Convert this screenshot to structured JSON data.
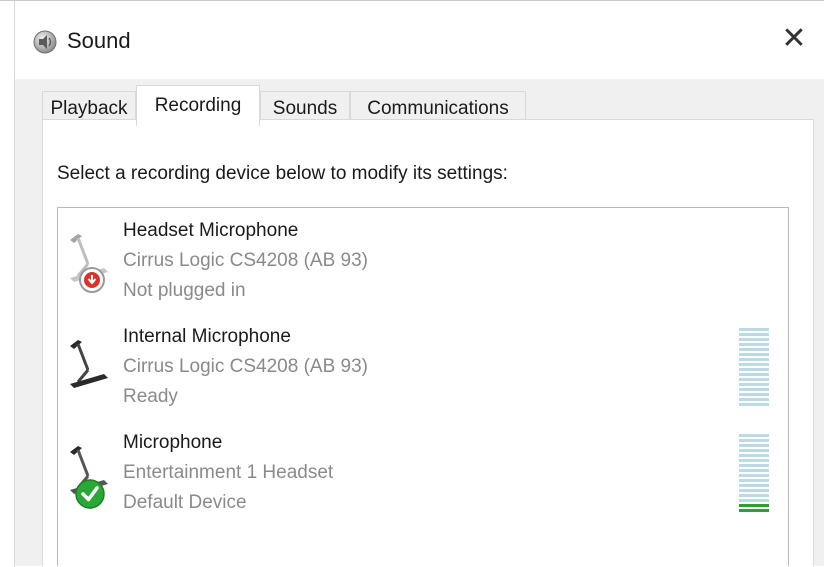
{
  "window": {
    "title": "Sound",
    "close_glyph": "✕"
  },
  "tabs": [
    {
      "label": "Playback",
      "active": false
    },
    {
      "label": "Recording",
      "active": true
    },
    {
      "label": "Sounds",
      "active": false
    },
    {
      "label": "Communications",
      "active": false
    }
  ],
  "panel": {
    "instruction": "Select a recording device below to modify its settings:"
  },
  "devices": [
    {
      "name": "Headset Microphone",
      "driver": "Cirrus Logic CS4208 (AB 93)",
      "status": "Not plugged in",
      "status_icon": "unplugged-icon",
      "disabled_look": true,
      "meter_level": null
    },
    {
      "name": "Internal Microphone",
      "driver": "Cirrus Logic CS4208 (AB 93)",
      "status": "Ready",
      "status_icon": null,
      "disabled_look": false,
      "meter_level": 0.0
    },
    {
      "name": "Microphone",
      "driver": "Entertainment 1 Headset",
      "status": "Default Device",
      "status_icon": "default-device-check-icon",
      "disabled_look": false,
      "meter_level": 0.1
    }
  ],
  "colors": {
    "meter_off": "#bcd9e6",
    "meter_on": "#2f9e35",
    "unplugged_red": "#d9342b",
    "check_green": "#2aa835"
  }
}
